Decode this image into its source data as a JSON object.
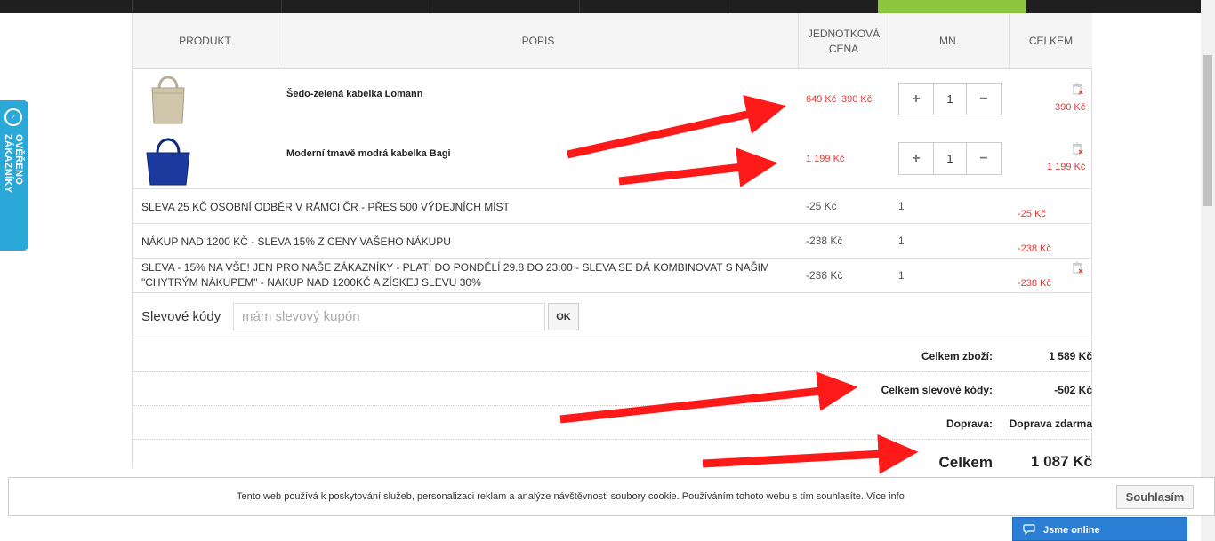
{
  "table": {
    "headers": [
      "PRODUKT",
      "POPIS",
      "JEDNOTKOVÁ CENA",
      "MN.",
      "CELKEM"
    ]
  },
  "products": [
    {
      "name": "Šedo-zelená kabelka Lomann",
      "old_price": "649 Kč",
      "price": "390 Kč",
      "qty": "1",
      "total": "390 Kč",
      "image": "beige-handbag"
    },
    {
      "name": "Moderní tmavě modrá kabelka Bagi",
      "old_price": "",
      "price": "1 199 Kč",
      "qty": "1",
      "total": "1 199 Kč",
      "image": "navy-handbag"
    }
  ],
  "discounts": [
    {
      "desc": "SLEVA 25 KČ OSOBNÍ ODBĚR V RÁMCI ČR - PŘES 500 VÝDEJNÍCH MÍST",
      "unit": "-25 Kč",
      "qty": "1",
      "total": "-25 Kč"
    },
    {
      "desc": "NÁKUP NAD 1200 KČ - SLEVA 15% Z CENY VAŠEHO NÁKUPU",
      "unit": "-238 Kč",
      "qty": "1",
      "total": "-238 Kč"
    },
    {
      "desc": "SLEVA - 15% NA VŠE! JEN PRO NAŠE ZÁKAZNÍKY - PLATÍ DO PONDĚLÍ 29.8 DO 23:00 - SLEVA SE DÁ KOMBINOVAT S NAŠIM \"CHYTRÝM NÁKUPEM\" - NAKUP NAD 1200KČ A ZÍSKEJ SLEVU 30%",
      "unit": "-238 Kč",
      "qty": "1",
      "total": "-238 Kč"
    }
  ],
  "coupon": {
    "label": "Slevové kódy",
    "placeholder": "mám slevový kupón",
    "button": "OK"
  },
  "summary": {
    "goods_label": "Celkem zboží:",
    "goods_value": "1 589 Kč",
    "codes_label": "Celkem slevové kódy:",
    "codes_value": "-502 Kč",
    "shipping_label": "Doprava:",
    "shipping_value": "Doprava zdarma",
    "total_label": "Celkem",
    "total_value": "1 087 Kč"
  },
  "badge": {
    "text": "OVĚŘENO ZÁKAZNÍKY"
  },
  "cookie": {
    "message": "Tento web používá k poskytování služeb, personalizaci reklam a analýze návštěvnosti soubory cookie. Používáním tohoto webu s tím souhlasíte. Více info",
    "button": "Souhlasím"
  },
  "chat": {
    "label": "Jsme online"
  },
  "colors": {
    "accent_green": "#8dc63f",
    "price_red": "#e53935",
    "badge_blue": "#2aa8d8",
    "chat_blue": "#2a7fd4",
    "arrow_red": "#ff1a1a"
  },
  "icons": [
    "trash-icon",
    "plus-icon",
    "minus-icon",
    "chat-bubble-icon",
    "verified-logo-icon"
  ]
}
